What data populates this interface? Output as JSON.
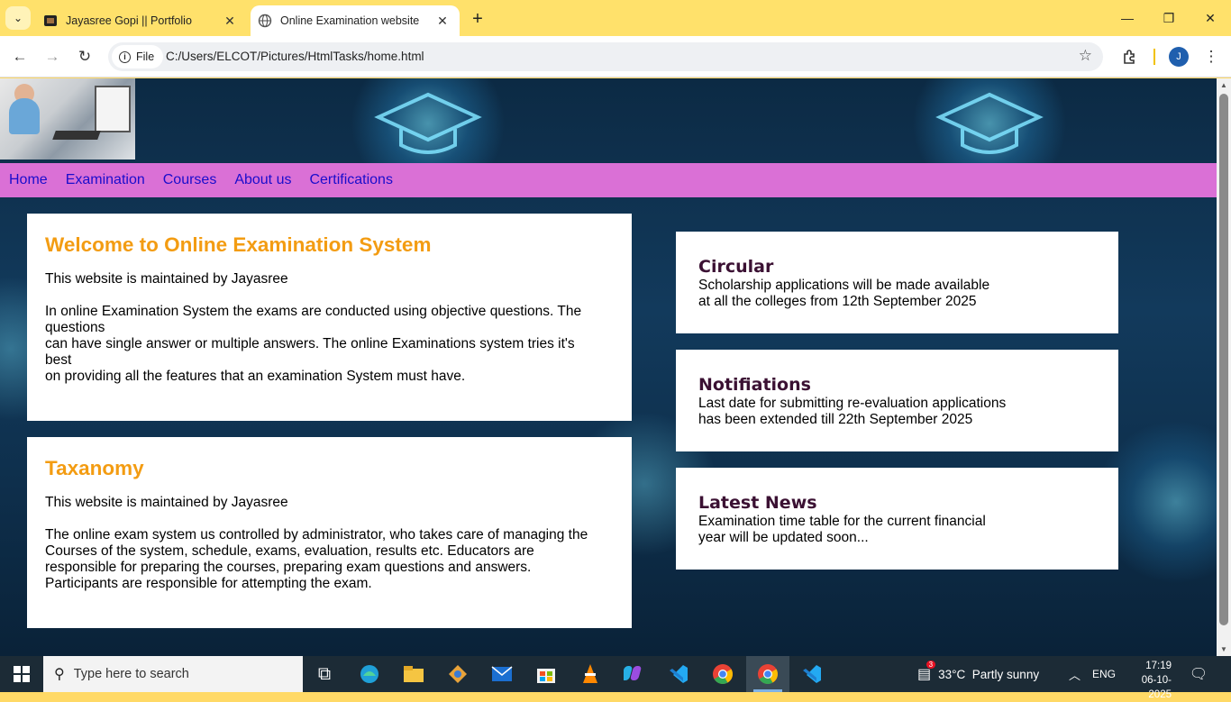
{
  "browser": {
    "tabs": [
      {
        "title": "Jayasree Gopi || Portfolio",
        "active": false
      },
      {
        "title": "Online Examination website",
        "active": true
      }
    ],
    "address": {
      "scheme_label": "File",
      "url": "C:/Users/ELCOT/Pictures/HtmlTasks/home.html"
    },
    "profile_initial": "J"
  },
  "page": {
    "nav": [
      "Home",
      "Examination",
      "Courses",
      "About us",
      "Certifications"
    ],
    "welcome": {
      "title": "Welcome to Online Examination System",
      "line1": "This website is maintained by Jayasree",
      "para_lines": [
        "In online Examination System the exams are conducted using objective questions. The",
        "questions",
        "can have single answer or multiple answers. The online Examinations system tries it's",
        "best",
        "on providing all the features that an examination System must have."
      ]
    },
    "taxonomy": {
      "title": "Taxanomy",
      "line1": "This website is maintained by Jayasree",
      "para_lines": [
        "The online exam system us controlled by administrator, who takes care of managing the",
        "Courses of the system, schedule, exams, evaluation, results etc. Educators are",
        "responsible for preparing the courses, preparing exam questions and answers.",
        "Participants are responsible for attempting the exam."
      ]
    },
    "side_cards": [
      {
        "title": "Circular",
        "lines": [
          "Scholarship applications will be made available",
          "at all the colleges from 12th September 2025"
        ]
      },
      {
        "title": "Notifiations",
        "lines": [
          "Last date for submitting re-evaluation applications",
          "has been extended till 22th September 2025"
        ]
      },
      {
        "title": "Latest News",
        "lines": [
          "Examination time table for the current financial",
          "year will be updated soon..."
        ]
      }
    ],
    "colors": {
      "nav_bg": "#da70d6",
      "nav_link": "#1a0dcc",
      "heading": "#f39c12",
      "side_heading": "#3b1133"
    }
  },
  "taskbar": {
    "search_placeholder": "Type here to search",
    "weather": "33°C  Partly sunny",
    "language": "ENG",
    "time": "17:19",
    "date": "06-10-2025",
    "widget_badge": "3"
  }
}
